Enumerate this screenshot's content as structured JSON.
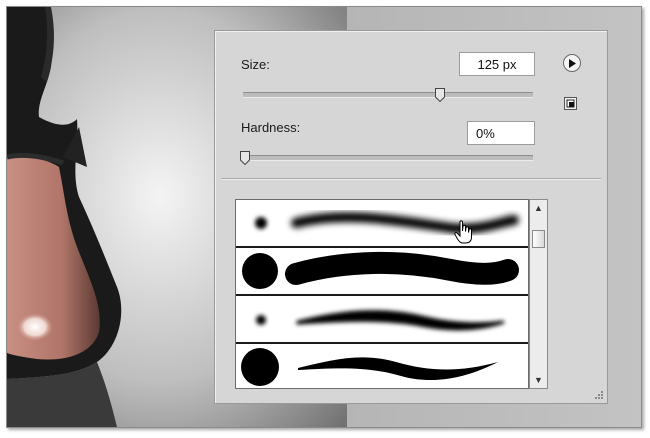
{
  "brush_panel": {
    "size_label": "Size:",
    "size_value": "125 px",
    "size_slider_fraction": 0.68,
    "hardness_label": "Hardness:",
    "hardness_value": "0%",
    "hardness_slider_fraction": 0.0,
    "menu_icon": "play-arrow-icon",
    "new_preset_icon": "new-preset-icon"
  },
  "brush_list": {
    "presets": [
      {
        "tip": "soft-round-small",
        "stroke": "soft"
      },
      {
        "tip": "hard-round",
        "stroke": "hard"
      },
      {
        "tip": "soft-round-small",
        "stroke": "soft-tapered"
      },
      {
        "tip": "hard-round",
        "stroke": "hard-tapered"
      }
    ],
    "scroll_up_icon": "scroll-up-arrow-icon",
    "scroll_down_icon": "scroll-down-arrow-icon"
  },
  "colors": {
    "panel_bg": "#d6d6d6",
    "field_bg": "#ffffff",
    "brush": "#000000"
  }
}
